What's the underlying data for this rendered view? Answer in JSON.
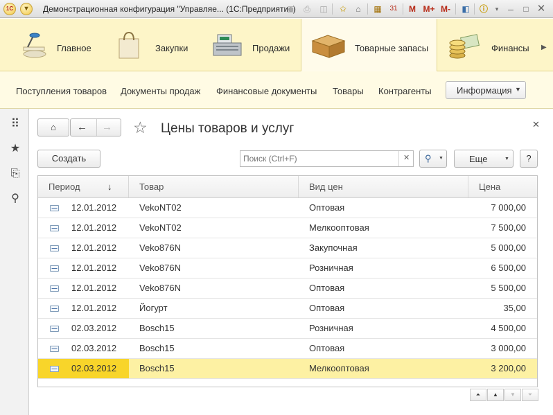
{
  "window": {
    "title": "Демонстрационная конфигурация \"Управляе... (1С:Предприятие)",
    "buttons": {
      "m": "M",
      "m_plus": "M+",
      "m_minus": "M-"
    }
  },
  "sections": [
    {
      "label": "Главное",
      "icon": "desk-lamp-icon",
      "active": false
    },
    {
      "label": "Закупки",
      "icon": "shopping-bag-icon",
      "active": false
    },
    {
      "label": "Продажи",
      "icon": "cash-register-icon",
      "active": false
    },
    {
      "label": "Товарные запасы",
      "icon": "box-icon",
      "active": true
    },
    {
      "label": "Финансы",
      "icon": "coins-icon",
      "active": false
    }
  ],
  "functions": [
    "Поступления товаров",
    "Документы продаж",
    "Финансовые документы",
    "Товары",
    "Контрагенты"
  ],
  "info_menu": "Информация",
  "form": {
    "title": "Цены товаров и услуг",
    "create_label": "Создать",
    "search_placeholder": "Поиск (Ctrl+F)",
    "more_label": "Еще",
    "help_label": "?"
  },
  "table": {
    "columns": [
      "Период",
      "Товар",
      "Вид цен",
      "Цена"
    ],
    "sort_indicator": "↓",
    "rows": [
      {
        "period": "12.01.2012",
        "product": "VekoNT02",
        "price_type": "Оптовая",
        "price": "7 000,00"
      },
      {
        "period": "12.01.2012",
        "product": "VekoNT02",
        "price_type": "Мелкооптовая",
        "price": "7 500,00"
      },
      {
        "period": "12.01.2012",
        "product": "Veko876N",
        "price_type": "Закупочная",
        "price": "5 000,00"
      },
      {
        "period": "12.01.2012",
        "product": "Veko876N",
        "price_type": "Розничная",
        "price": "6 500,00"
      },
      {
        "period": "12.01.2012",
        "product": "Veko876N",
        "price_type": "Оптовая",
        "price": "5 500,00"
      },
      {
        "period": "12.01.2012",
        "product": "Йогурт",
        "price_type": "Оптовая",
        "price": "35,00"
      },
      {
        "period": "02.03.2012",
        "product": "Bosch15",
        "price_type": "Розничная",
        "price": "4 500,00"
      },
      {
        "period": "02.03.2012",
        "product": "Bosch15",
        "price_type": "Оптовая",
        "price": "3 000,00"
      },
      {
        "period": "02.03.2012",
        "product": "Bosch15",
        "price_type": "Мелкооптовая",
        "price": "3 200,00"
      }
    ],
    "selected_row": 8
  }
}
